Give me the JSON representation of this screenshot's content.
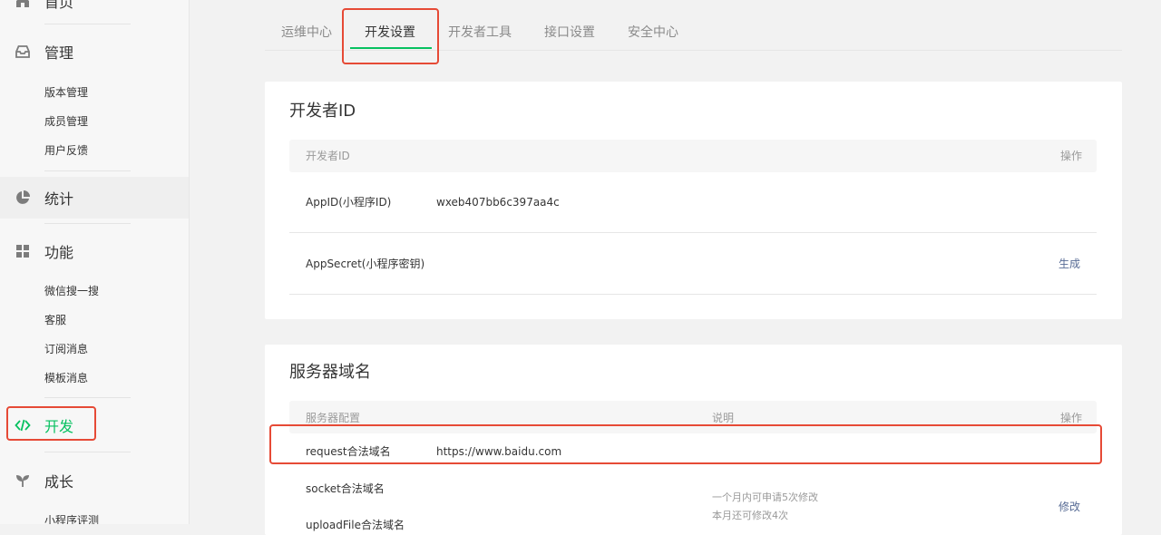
{
  "sidebar": {
    "home_label": "首页",
    "manage": {
      "label": "管理",
      "items": [
        "版本管理",
        "成员管理",
        "用户反馈"
      ]
    },
    "stats": {
      "label": "统计"
    },
    "features": {
      "label": "功能",
      "items": [
        "微信搜一搜",
        "客服",
        "订阅消息",
        "模板消息"
      ]
    },
    "dev": {
      "label": "开发"
    },
    "growth": {
      "label": "成长",
      "items": [
        "小程序评测"
      ]
    },
    "icons": [
      "home-icon",
      "inbox-icon",
      "pie-chart-icon",
      "grid-icon",
      "code-icon",
      "sprout-icon"
    ]
  },
  "tabs": [
    {
      "label": "运维中心"
    },
    {
      "label": "开发设置"
    },
    {
      "label": "开发者工具"
    },
    {
      "label": "接口设置"
    },
    {
      "label": "安全中心"
    }
  ],
  "developer_id": {
    "title": "开发者ID",
    "header": {
      "col1": "开发者ID",
      "col_op": "操作"
    },
    "rows": [
      {
        "name": "AppID(小程序ID)",
        "value": "wxeb407bb6c397aa4c",
        "op": ""
      },
      {
        "name": "AppSecret(小程序密钥)",
        "value": "",
        "op": "生成"
      }
    ]
  },
  "server_domain": {
    "title": "服务器域名",
    "header": {
      "col1": "服务器配置",
      "col2": "说明",
      "col_op": "操作"
    },
    "rows": [
      {
        "name": "request合法域名",
        "value": "https://www.baidu.com"
      },
      {
        "name": "socket合法域名",
        "value": ""
      },
      {
        "name": "uploadFile合法域名",
        "value": ""
      }
    ],
    "note_line1": "一个月内可申请5次修改",
    "note_line2": "本月还可修改4次",
    "op": "修改"
  },
  "colors": {
    "accent": "#07c160",
    "link": "#576b95",
    "highlight": "#e64a36"
  }
}
